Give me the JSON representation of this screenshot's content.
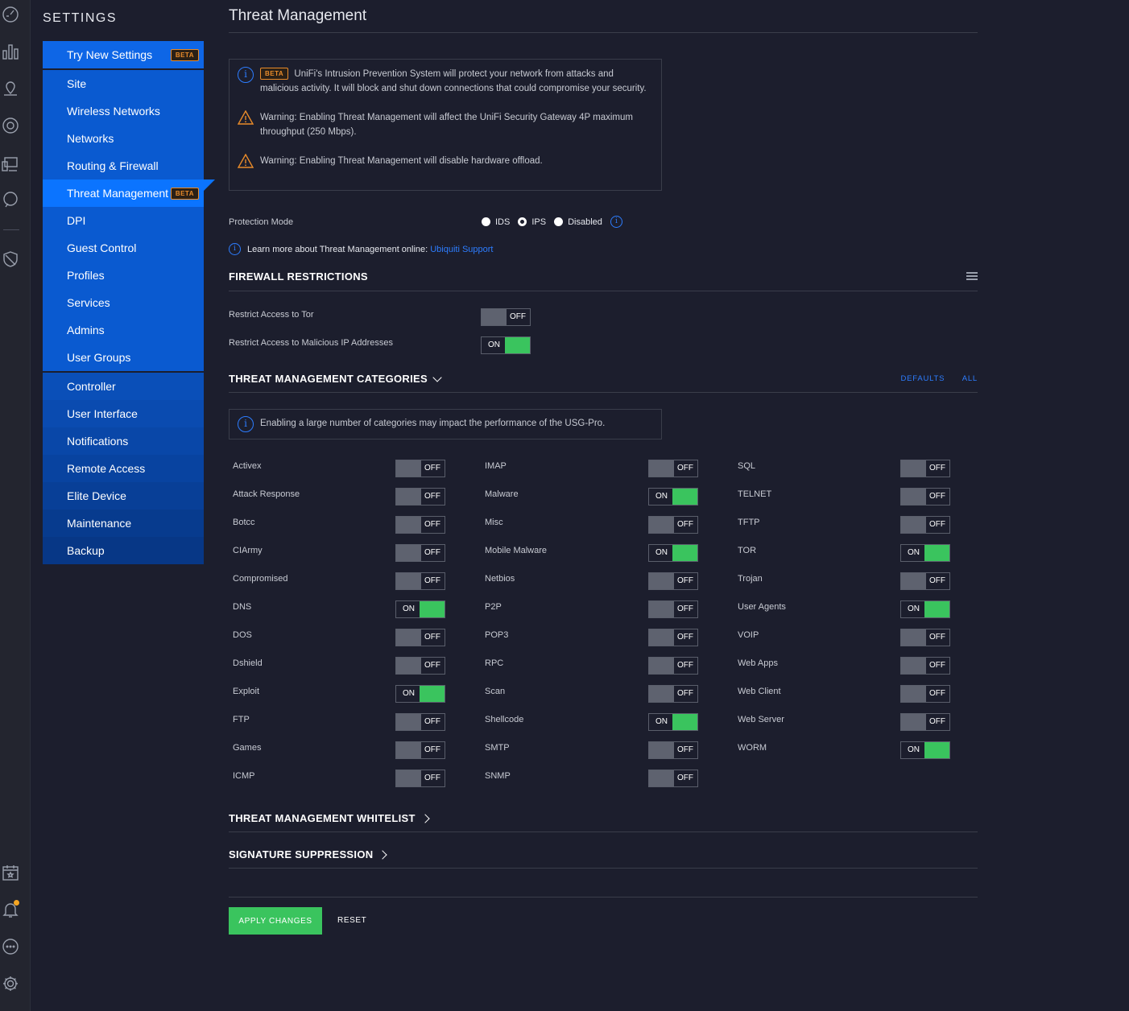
{
  "sidebar": {
    "title": "SETTINGS",
    "beta_badge": "BETA",
    "groups": [
      [
        {
          "label": "Try New Settings",
          "beta": true
        }
      ],
      [
        {
          "label": "Site"
        },
        {
          "label": "Wireless Networks"
        },
        {
          "label": "Networks"
        },
        {
          "label": "Routing & Firewall"
        },
        {
          "label": "Threat Management",
          "beta": true,
          "active": true
        },
        {
          "label": "DPI"
        },
        {
          "label": "Guest Control"
        },
        {
          "label": "Profiles"
        },
        {
          "label": "Services"
        },
        {
          "label": "Admins"
        },
        {
          "label": "User Groups"
        }
      ],
      [
        {
          "label": "Controller"
        },
        {
          "label": "User Interface"
        },
        {
          "label": "Notifications"
        },
        {
          "label": "Remote Access"
        },
        {
          "label": "Elite Device"
        },
        {
          "label": "Maintenance"
        },
        {
          "label": "Backup"
        }
      ]
    ]
  },
  "rail_icons": [
    "dashboard-icon",
    "statistics-icon",
    "map-icon",
    "devices-icon",
    "clients-icon",
    "insights-icon",
    "security-shield-icon",
    "events-calendar-icon",
    "alerts-bell-icon",
    "chat-icon",
    "settings-gear-icon"
  ],
  "page": {
    "title": "Threat Management",
    "notice": {
      "beta_badge": "BETA",
      "ips_text": "UniFi's Intrusion Prevention System will protect your network from attacks and malicious activity. It will block and shut down connections that could compromise your security.",
      "warning_1": "Warning: Enabling Threat Management will affect the UniFi Security Gateway 4P maximum throughput (250 Mbps).",
      "warning_2": "Warning: Enabling Threat Management will disable hardware offload."
    },
    "protection_mode": {
      "label": "Protection Mode",
      "options": [
        "IDS",
        "IPS",
        "Disabled"
      ],
      "selected": "IPS"
    },
    "learn_more": {
      "text": "Learn more about Threat Management online:",
      "link": "Ubiquiti Support"
    },
    "firewall": {
      "title": "FIREWALL RESTRICTIONS",
      "items": [
        {
          "label": "Restrict Access to Tor",
          "state": "OFF"
        },
        {
          "label": "Restrict Access to Malicious IP Addresses",
          "state": "ON"
        }
      ]
    },
    "categories": {
      "title": "THREAT MANAGEMENT CATEGORIES",
      "defaults_link": "DEFAULTS",
      "all_link": "ALL",
      "notice": "Enabling a large number of categories may impact the performance of the USG-Pro.",
      "columns": [
        [
          {
            "label": "Activex",
            "state": "OFF"
          },
          {
            "label": "Attack Response",
            "state": "OFF"
          },
          {
            "label": "Botcc",
            "state": "OFF"
          },
          {
            "label": "CIArmy",
            "state": "OFF"
          },
          {
            "label": "Compromised",
            "state": "OFF"
          },
          {
            "label": "DNS",
            "state": "ON"
          },
          {
            "label": "DOS",
            "state": "OFF"
          },
          {
            "label": "Dshield",
            "state": "OFF"
          },
          {
            "label": "Exploit",
            "state": "ON"
          },
          {
            "label": "FTP",
            "state": "OFF"
          },
          {
            "label": "Games",
            "state": "OFF"
          },
          {
            "label": "ICMP",
            "state": "OFF"
          }
        ],
        [
          {
            "label": "IMAP",
            "state": "OFF"
          },
          {
            "label": "Malware",
            "state": "ON"
          },
          {
            "label": "Misc",
            "state": "OFF"
          },
          {
            "label": "Mobile Malware",
            "state": "ON"
          },
          {
            "label": "Netbios",
            "state": "OFF"
          },
          {
            "label": "P2P",
            "state": "OFF"
          },
          {
            "label": "POP3",
            "state": "OFF"
          },
          {
            "label": "RPC",
            "state": "OFF"
          },
          {
            "label": "Scan",
            "state": "OFF"
          },
          {
            "label": "Shellcode",
            "state": "ON"
          },
          {
            "label": "SMTP",
            "state": "OFF"
          },
          {
            "label": "SNMP",
            "state": "OFF"
          }
        ],
        [
          {
            "label": "SQL",
            "state": "OFF"
          },
          {
            "label": "TELNET",
            "state": "OFF"
          },
          {
            "label": "TFTP",
            "state": "OFF"
          },
          {
            "label": "TOR",
            "state": "ON"
          },
          {
            "label": "Trojan",
            "state": "OFF"
          },
          {
            "label": "User Agents",
            "state": "ON"
          },
          {
            "label": "VOIP",
            "state": "OFF"
          },
          {
            "label": "Web Apps",
            "state": "OFF"
          },
          {
            "label": "Web Client",
            "state": "OFF"
          },
          {
            "label": "Web Server",
            "state": "OFF"
          },
          {
            "label": "WORM",
            "state": "ON"
          }
        ]
      ]
    },
    "whitelist_title": "THREAT MANAGEMENT WHITELIST",
    "suppression_title": "SIGNATURE SUPPRESSION",
    "apply_label": "APPLY CHANGES",
    "reset_label": "RESET"
  },
  "colors": {
    "accent_blue": "#0b74ff",
    "on_green": "#3ac45e",
    "warning_orange": "#e98b2a",
    "background": "#1c1e2d"
  }
}
